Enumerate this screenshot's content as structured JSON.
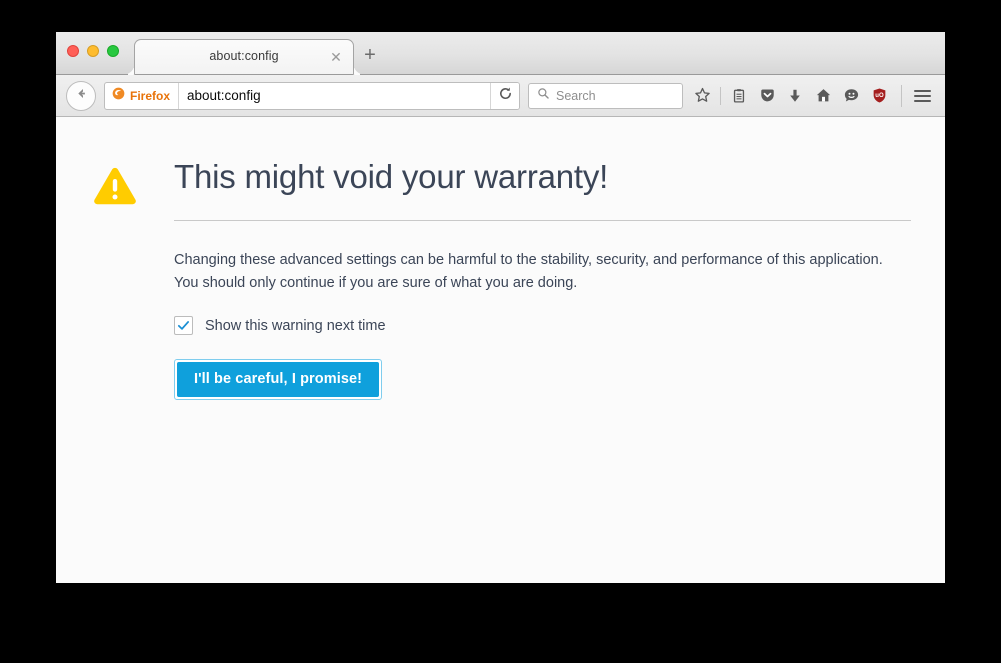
{
  "window": {
    "traffic_lights": [
      {
        "name": "close",
        "color": "#ff5f57"
      },
      {
        "name": "minimize",
        "color": "#febc2e"
      },
      {
        "name": "zoom",
        "color": "#28c840"
      }
    ]
  },
  "tabbar": {
    "tab_title": "about:config",
    "close_glyph": "✕",
    "newtab_glyph": "+"
  },
  "toolbar": {
    "identity_label": "Firefox",
    "url_value": "about:config",
    "search_placeholder": "Search",
    "icons": [
      {
        "name": "bookmark-star-icon",
        "title": "Bookmark this page"
      },
      {
        "name": "library-icon",
        "title": "Show your bookmarks"
      },
      {
        "name": "pocket-icon",
        "title": "Save to Pocket"
      },
      {
        "name": "downloads-icon",
        "title": "Downloads"
      },
      {
        "name": "home-icon",
        "title": "Home"
      },
      {
        "name": "hello-smiley-icon",
        "title": "Firefox Hello"
      },
      {
        "name": "ublock-origin-icon",
        "title": "uBlock Origin",
        "badge": "uO",
        "color": "#a41e1e"
      }
    ]
  },
  "page": {
    "title": "This might void your warranty!",
    "body": "Changing these advanced settings can be harmful to the stability, security, and performance of this application. You should only continue if you are sure of what you are doing.",
    "checkbox_label": "Show this warning next time",
    "checkbox_checked": true,
    "button_label": "I'll be careful, I promise!",
    "accent_color": "#0fa0dc",
    "warning_color": "#ffcc00",
    "text_color": "#3b4557"
  }
}
